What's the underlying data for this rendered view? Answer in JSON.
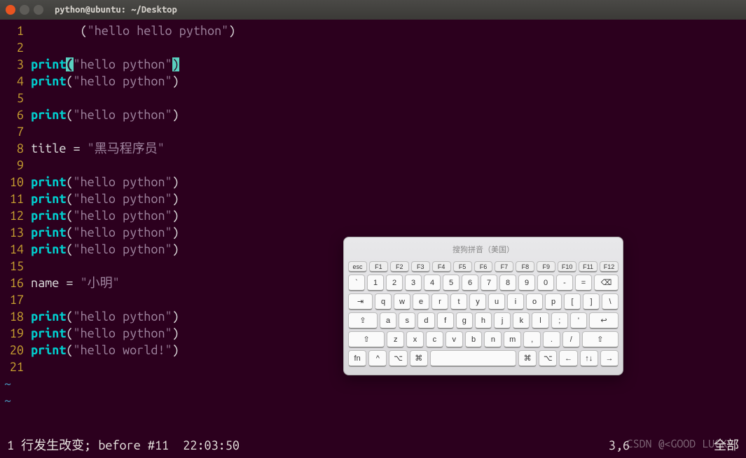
{
  "window": {
    "title": "python@ubuntu: ~/Desktop"
  },
  "code": {
    "lines": [
      {
        "n": "1",
        "segs": [
          {
            "t": "       (",
            "c": "paren"
          },
          {
            "t": "\"hello hello python\"",
            "c": "str"
          },
          {
            "t": ")",
            "c": "paren"
          }
        ]
      },
      {
        "n": "2",
        "segs": []
      },
      {
        "n": "3",
        "segs": [
          {
            "t": "print",
            "c": "kw"
          },
          {
            "t": "(",
            "c": "hl-paren"
          },
          {
            "t": "\"hello python\"",
            "c": "str"
          },
          {
            "t": ")",
            "c": "cursor-cell"
          }
        ]
      },
      {
        "n": "4",
        "segs": [
          {
            "t": "print",
            "c": "kw"
          },
          {
            "t": "(",
            "c": "paren"
          },
          {
            "t": "\"hello python\"",
            "c": "str"
          },
          {
            "t": ")",
            "c": "paren"
          }
        ]
      },
      {
        "n": "5",
        "segs": []
      },
      {
        "n": "6",
        "segs": [
          {
            "t": "print",
            "c": "kw"
          },
          {
            "t": "(",
            "c": "paren"
          },
          {
            "t": "\"hello python\"",
            "c": "str"
          },
          {
            "t": ")",
            "c": "paren"
          }
        ]
      },
      {
        "n": "7",
        "segs": []
      },
      {
        "n": "8",
        "segs": [
          {
            "t": "title ",
            "c": "ident"
          },
          {
            "t": "= ",
            "c": "op"
          },
          {
            "t": "\"黑马程序员\"",
            "c": "str"
          }
        ]
      },
      {
        "n": "9",
        "segs": []
      },
      {
        "n": "10",
        "segs": [
          {
            "t": "print",
            "c": "kw"
          },
          {
            "t": "(",
            "c": "paren"
          },
          {
            "t": "\"hello python\"",
            "c": "str"
          },
          {
            "t": ")",
            "c": "paren"
          }
        ]
      },
      {
        "n": "11",
        "segs": [
          {
            "t": "print",
            "c": "kw"
          },
          {
            "t": "(",
            "c": "paren"
          },
          {
            "t": "\"hello python\"",
            "c": "str"
          },
          {
            "t": ")",
            "c": "paren"
          }
        ]
      },
      {
        "n": "12",
        "segs": [
          {
            "t": "print",
            "c": "kw"
          },
          {
            "t": "(",
            "c": "paren"
          },
          {
            "t": "\"hello python\"",
            "c": "str"
          },
          {
            "t": ")",
            "c": "paren"
          }
        ]
      },
      {
        "n": "13",
        "segs": [
          {
            "t": "print",
            "c": "kw"
          },
          {
            "t": "(",
            "c": "paren"
          },
          {
            "t": "\"hello python\"",
            "c": "str"
          },
          {
            "t": ")",
            "c": "paren"
          }
        ]
      },
      {
        "n": "14",
        "segs": [
          {
            "t": "print",
            "c": "kw"
          },
          {
            "t": "(",
            "c": "paren"
          },
          {
            "t": "\"hello python\"",
            "c": "str"
          },
          {
            "t": ")",
            "c": "paren"
          }
        ]
      },
      {
        "n": "15",
        "segs": []
      },
      {
        "n": "16",
        "segs": [
          {
            "t": "name ",
            "c": "ident"
          },
          {
            "t": "= ",
            "c": "op"
          },
          {
            "t": "\"小明\"",
            "c": "str"
          }
        ]
      },
      {
        "n": "17",
        "segs": []
      },
      {
        "n": "18",
        "segs": [
          {
            "t": "print",
            "c": "kw"
          },
          {
            "t": "(",
            "c": "paren"
          },
          {
            "t": "\"hello python\"",
            "c": "str"
          },
          {
            "t": ")",
            "c": "paren"
          }
        ]
      },
      {
        "n": "19",
        "segs": [
          {
            "t": "print",
            "c": "kw"
          },
          {
            "t": "(",
            "c": "paren"
          },
          {
            "t": "\"hello python\"",
            "c": "str"
          },
          {
            "t": ")",
            "c": "paren"
          }
        ]
      },
      {
        "n": "20",
        "segs": [
          {
            "t": "print",
            "c": "kw"
          },
          {
            "t": "(",
            "c": "paren"
          },
          {
            "t": "\"hello world!\"",
            "c": "str"
          },
          {
            "t": ")",
            "c": "paren"
          }
        ]
      },
      {
        "n": "21",
        "segs": []
      }
    ],
    "tildes": [
      "~",
      "~"
    ]
  },
  "status": {
    "left": "1 行发生改变; before #11  22:03:50",
    "pos": "3,6",
    "right": "全部"
  },
  "watermark": "CSDN @<GOOD LUCK>",
  "osk": {
    "title": "搜狗拼音（美国）",
    "rows": {
      "fn": [
        "esc",
        "F1",
        "F2",
        "F3",
        "F4",
        "F5",
        "F6",
        "F7",
        "F8",
        "F9",
        "F10",
        "F11",
        "F12"
      ],
      "num": [
        "`",
        "1",
        "2",
        "3",
        "4",
        "5",
        "6",
        "7",
        "8",
        "9",
        "0",
        "-",
        "=",
        "⌫"
      ],
      "q": [
        "⇥",
        "q",
        "w",
        "e",
        "r",
        "t",
        "y",
        "u",
        "i",
        "o",
        "p",
        "[",
        "]",
        "\\"
      ],
      "a": [
        "⇪",
        "a",
        "s",
        "d",
        "f",
        "g",
        "h",
        "j",
        "k",
        "l",
        ";",
        "'",
        "↩"
      ],
      "z": [
        "⇧",
        "z",
        "x",
        "c",
        "v",
        "b",
        "n",
        "m",
        ",",
        ".",
        "/",
        "⇧"
      ],
      "bot": [
        "fn",
        "^",
        "⌥",
        "⌘",
        " ",
        "⌘",
        "⌥",
        "←",
        "↑↓",
        "→"
      ]
    }
  }
}
